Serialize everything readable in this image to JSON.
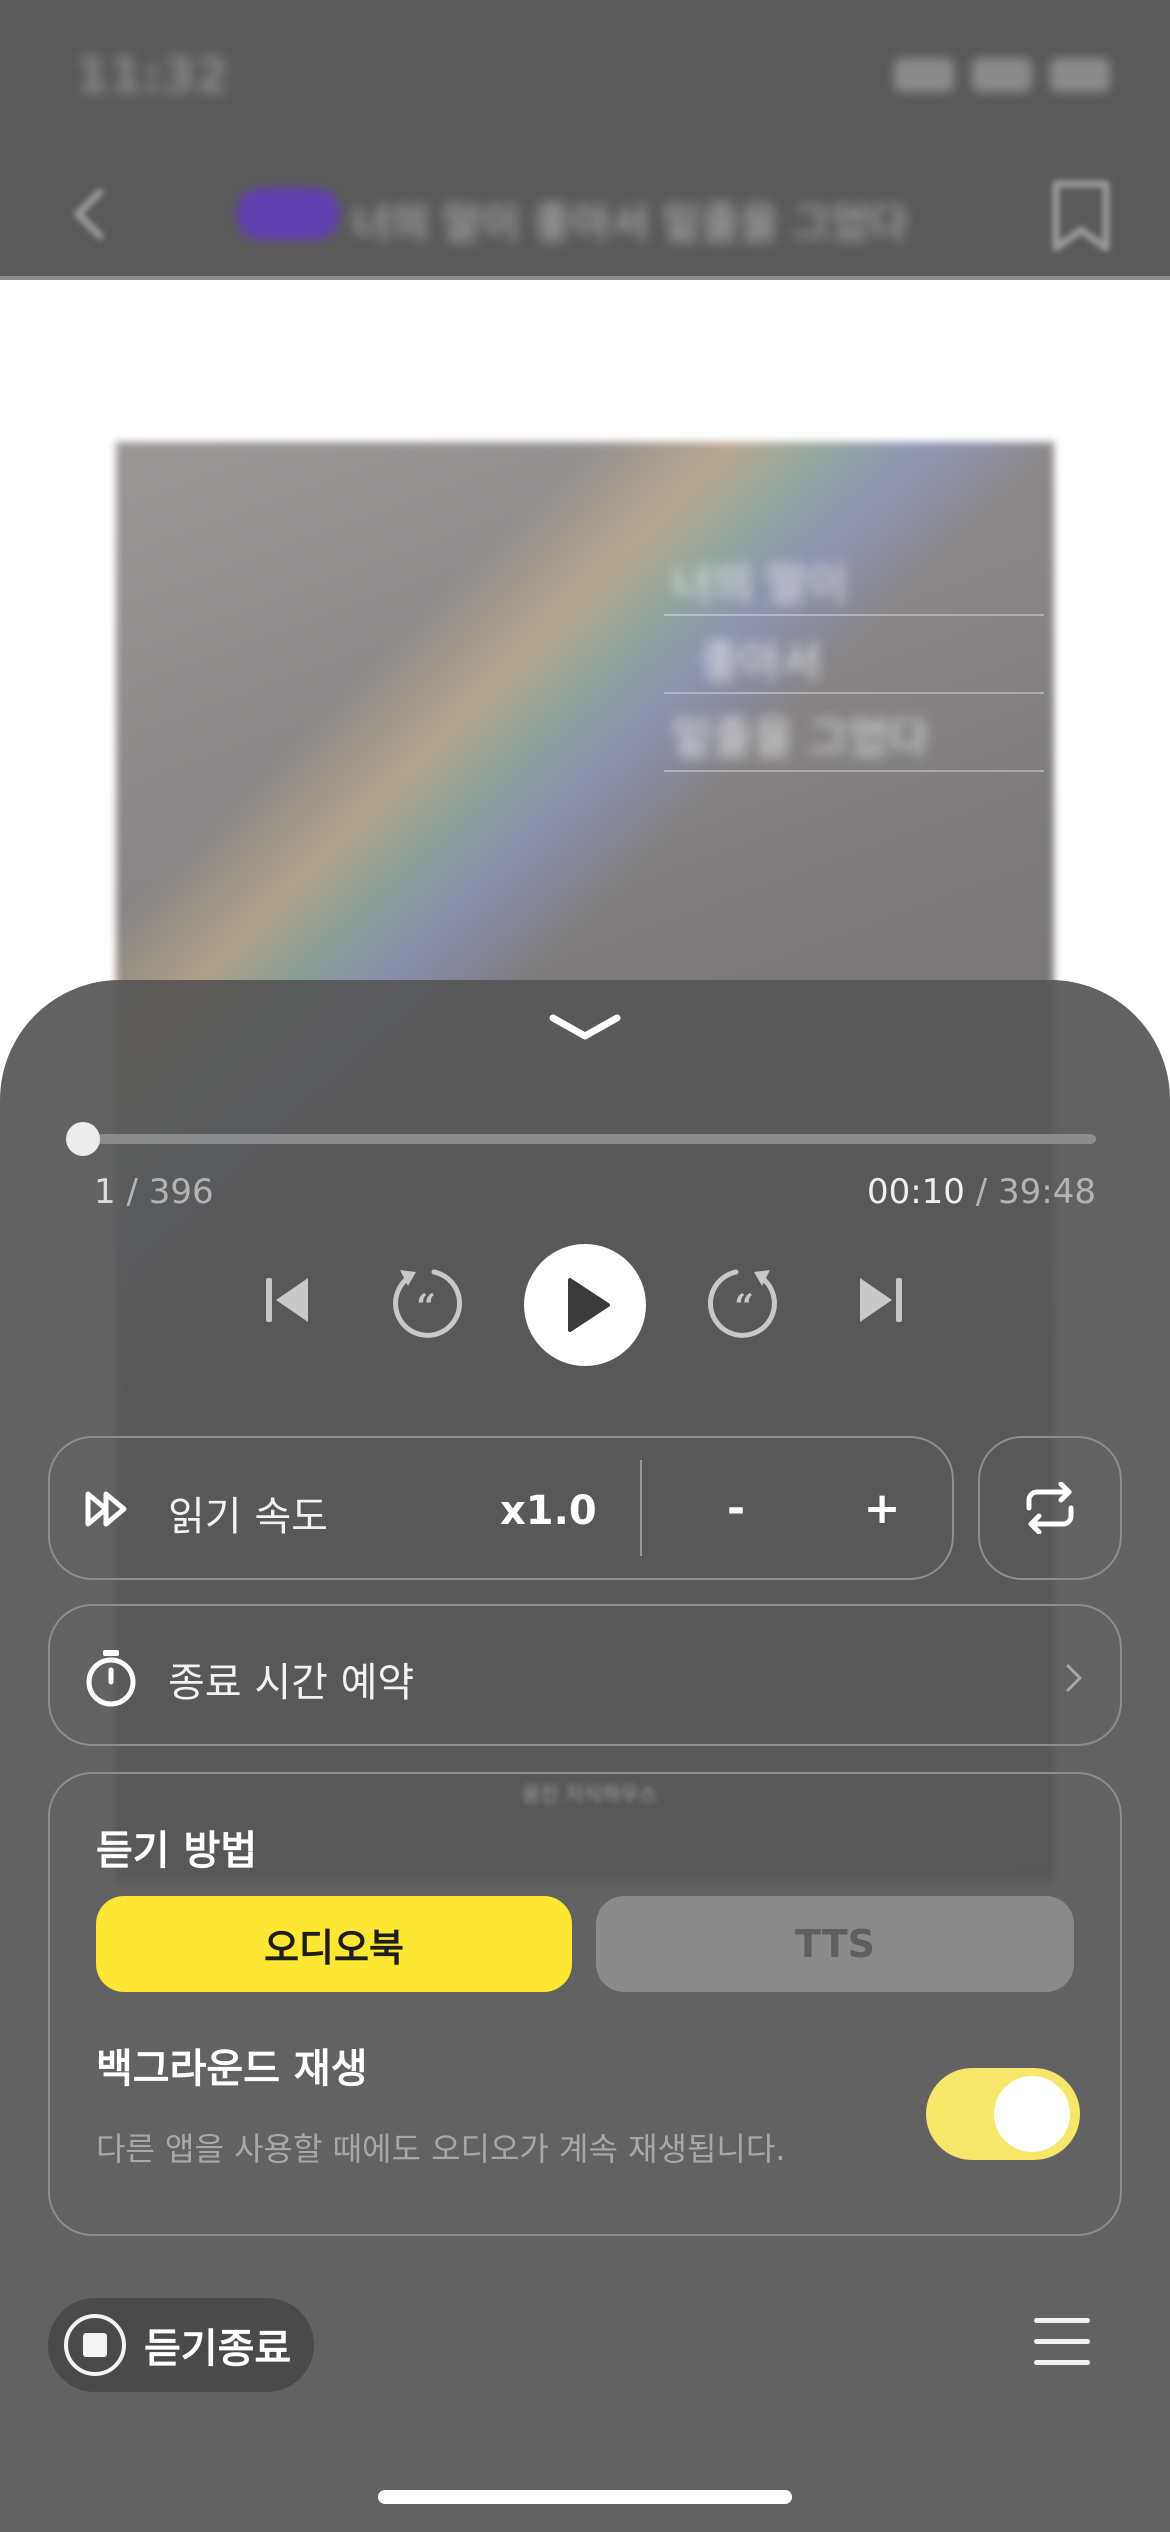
{
  "status_bar": {
    "time": "11:32"
  },
  "nav": {
    "title": "너의 말이 좋아서 밑줄을 그었다"
  },
  "cover": {
    "lines": [
      "너의 말이",
      "좋아서",
      "밑줄을 그었다"
    ],
    "author": "",
    "publisher": "웅진 지식하우스"
  },
  "player": {
    "progress": 0.0025,
    "current_page": "1",
    "total_pages": "396",
    "current_time": "00:10",
    "total_time": "39:48",
    "separator": "/"
  },
  "speed": {
    "label": "읽기 속도",
    "value": "x1.0",
    "minus": "-",
    "plus": "+"
  },
  "timer": {
    "label": "종료 시간 예약"
  },
  "listen_method": {
    "title": "듣기 방법",
    "options": [
      "오디오북",
      "TTS"
    ],
    "selected": "오디오북"
  },
  "background_play": {
    "title": "백그라운드 재생",
    "description": "다른 앱을 사용할 때에도 오디오가 계속 재생됩니다.",
    "enabled": true
  },
  "footer": {
    "stop_label": "듣기종료"
  },
  "colors": {
    "accent_yellow": "#fde732",
    "sheet_bg": "#565656"
  }
}
